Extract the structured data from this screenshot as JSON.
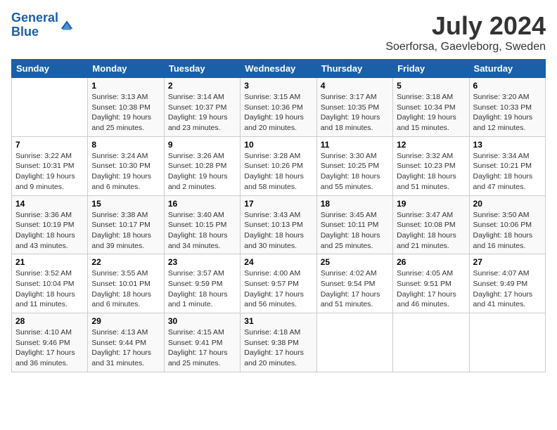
{
  "header": {
    "logo_line1": "General",
    "logo_line2": "Blue",
    "title": "July 2024",
    "subtitle": "Soerforsa, Gaevleborg, Sweden"
  },
  "weekdays": [
    "Sunday",
    "Monday",
    "Tuesday",
    "Wednesday",
    "Thursday",
    "Friday",
    "Saturday"
  ],
  "weeks": [
    [
      {
        "day": "",
        "sunrise": "",
        "sunset": "",
        "daylight": ""
      },
      {
        "day": "1",
        "sunrise": "Sunrise: 3:13 AM",
        "sunset": "Sunset: 10:38 PM",
        "daylight": "Daylight: 19 hours and 25 minutes."
      },
      {
        "day": "2",
        "sunrise": "Sunrise: 3:14 AM",
        "sunset": "Sunset: 10:37 PM",
        "daylight": "Daylight: 19 hours and 23 minutes."
      },
      {
        "day": "3",
        "sunrise": "Sunrise: 3:15 AM",
        "sunset": "Sunset: 10:36 PM",
        "daylight": "Daylight: 19 hours and 20 minutes."
      },
      {
        "day": "4",
        "sunrise": "Sunrise: 3:17 AM",
        "sunset": "Sunset: 10:35 PM",
        "daylight": "Daylight: 19 hours and 18 minutes."
      },
      {
        "day": "5",
        "sunrise": "Sunrise: 3:18 AM",
        "sunset": "Sunset: 10:34 PM",
        "daylight": "Daylight: 19 hours and 15 minutes."
      },
      {
        "day": "6",
        "sunrise": "Sunrise: 3:20 AM",
        "sunset": "Sunset: 10:33 PM",
        "daylight": "Daylight: 19 hours and 12 minutes."
      }
    ],
    [
      {
        "day": "7",
        "sunrise": "Sunrise: 3:22 AM",
        "sunset": "Sunset: 10:31 PM",
        "daylight": "Daylight: 19 hours and 9 minutes."
      },
      {
        "day": "8",
        "sunrise": "Sunrise: 3:24 AM",
        "sunset": "Sunset: 10:30 PM",
        "daylight": "Daylight: 19 hours and 6 minutes."
      },
      {
        "day": "9",
        "sunrise": "Sunrise: 3:26 AM",
        "sunset": "Sunset: 10:28 PM",
        "daylight": "Daylight: 19 hours and 2 minutes."
      },
      {
        "day": "10",
        "sunrise": "Sunrise: 3:28 AM",
        "sunset": "Sunset: 10:26 PM",
        "daylight": "Daylight: 18 hours and 58 minutes."
      },
      {
        "day": "11",
        "sunrise": "Sunrise: 3:30 AM",
        "sunset": "Sunset: 10:25 PM",
        "daylight": "Daylight: 18 hours and 55 minutes."
      },
      {
        "day": "12",
        "sunrise": "Sunrise: 3:32 AM",
        "sunset": "Sunset: 10:23 PM",
        "daylight": "Daylight: 18 hours and 51 minutes."
      },
      {
        "day": "13",
        "sunrise": "Sunrise: 3:34 AM",
        "sunset": "Sunset: 10:21 PM",
        "daylight": "Daylight: 18 hours and 47 minutes."
      }
    ],
    [
      {
        "day": "14",
        "sunrise": "Sunrise: 3:36 AM",
        "sunset": "Sunset: 10:19 PM",
        "daylight": "Daylight: 18 hours and 43 minutes."
      },
      {
        "day": "15",
        "sunrise": "Sunrise: 3:38 AM",
        "sunset": "Sunset: 10:17 PM",
        "daylight": "Daylight: 18 hours and 39 minutes."
      },
      {
        "day": "16",
        "sunrise": "Sunrise: 3:40 AM",
        "sunset": "Sunset: 10:15 PM",
        "daylight": "Daylight: 18 hours and 34 minutes."
      },
      {
        "day": "17",
        "sunrise": "Sunrise: 3:43 AM",
        "sunset": "Sunset: 10:13 PM",
        "daylight": "Daylight: 18 hours and 30 minutes."
      },
      {
        "day": "18",
        "sunrise": "Sunrise: 3:45 AM",
        "sunset": "Sunset: 10:11 PM",
        "daylight": "Daylight: 18 hours and 25 minutes."
      },
      {
        "day": "19",
        "sunrise": "Sunrise: 3:47 AM",
        "sunset": "Sunset: 10:08 PM",
        "daylight": "Daylight: 18 hours and 21 minutes."
      },
      {
        "day": "20",
        "sunrise": "Sunrise: 3:50 AM",
        "sunset": "Sunset: 10:06 PM",
        "daylight": "Daylight: 18 hours and 16 minutes."
      }
    ],
    [
      {
        "day": "21",
        "sunrise": "Sunrise: 3:52 AM",
        "sunset": "Sunset: 10:04 PM",
        "daylight": "Daylight: 18 hours and 11 minutes."
      },
      {
        "day": "22",
        "sunrise": "Sunrise: 3:55 AM",
        "sunset": "Sunset: 10:01 PM",
        "daylight": "Daylight: 18 hours and 6 minutes."
      },
      {
        "day": "23",
        "sunrise": "Sunrise: 3:57 AM",
        "sunset": "Sunset: 9:59 PM",
        "daylight": "Daylight: 18 hours and 1 minute."
      },
      {
        "day": "24",
        "sunrise": "Sunrise: 4:00 AM",
        "sunset": "Sunset: 9:57 PM",
        "daylight": "Daylight: 17 hours and 56 minutes."
      },
      {
        "day": "25",
        "sunrise": "Sunrise: 4:02 AM",
        "sunset": "Sunset: 9:54 PM",
        "daylight": "Daylight: 17 hours and 51 minutes."
      },
      {
        "day": "26",
        "sunrise": "Sunrise: 4:05 AM",
        "sunset": "Sunset: 9:51 PM",
        "daylight": "Daylight: 17 hours and 46 minutes."
      },
      {
        "day": "27",
        "sunrise": "Sunrise: 4:07 AM",
        "sunset": "Sunset: 9:49 PM",
        "daylight": "Daylight: 17 hours and 41 minutes."
      }
    ],
    [
      {
        "day": "28",
        "sunrise": "Sunrise: 4:10 AM",
        "sunset": "Sunset: 9:46 PM",
        "daylight": "Daylight: 17 hours and 36 minutes."
      },
      {
        "day": "29",
        "sunrise": "Sunrise: 4:13 AM",
        "sunset": "Sunset: 9:44 PM",
        "daylight": "Daylight: 17 hours and 31 minutes."
      },
      {
        "day": "30",
        "sunrise": "Sunrise: 4:15 AM",
        "sunset": "Sunset: 9:41 PM",
        "daylight": "Daylight: 17 hours and 25 minutes."
      },
      {
        "day": "31",
        "sunrise": "Sunrise: 4:18 AM",
        "sunset": "Sunset: 9:38 PM",
        "daylight": "Daylight: 17 hours and 20 minutes."
      },
      {
        "day": "",
        "sunrise": "",
        "sunset": "",
        "daylight": ""
      },
      {
        "day": "",
        "sunrise": "",
        "sunset": "",
        "daylight": ""
      },
      {
        "day": "",
        "sunrise": "",
        "sunset": "",
        "daylight": ""
      }
    ]
  ]
}
